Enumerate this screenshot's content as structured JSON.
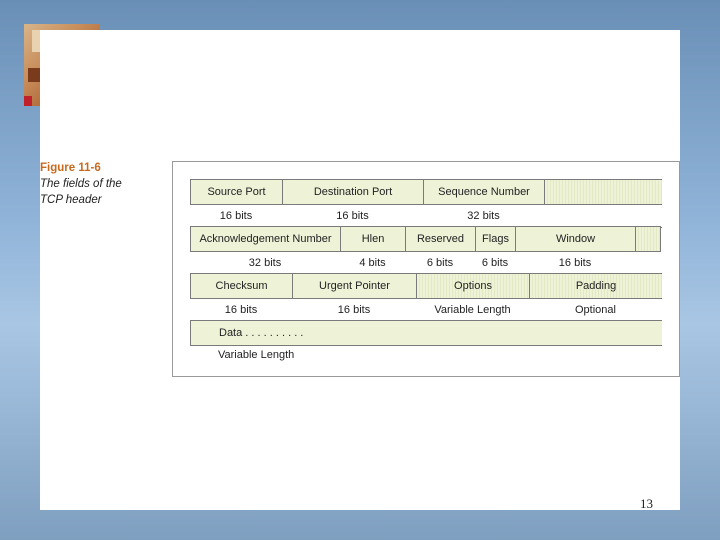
{
  "figure": {
    "label": "Figure 11-6",
    "caption_lines": [
      "The fields of the",
      "TCP header"
    ]
  },
  "rows": [
    {
      "fields": [
        "Source Port",
        "Destination Port",
        "Sequence Number",
        ""
      ],
      "sizes": [
        "16 bits",
        "16 bits",
        "32 bits",
        ""
      ]
    },
    {
      "fields": [
        "Acknowledgement Number",
        "Hlen",
        "Reserved",
        "Flags",
        "Window",
        ""
      ],
      "sizes": [
        "32 bits",
        "4 bits",
        "6 bits",
        "6 bits",
        "16 bits",
        ""
      ]
    },
    {
      "fields": [
        "Checksum",
        "Urgent Pointer",
        "Options",
        "Padding"
      ],
      "sizes": [
        "16 bits",
        "16 bits",
        "Variable Length",
        "Optional"
      ]
    },
    {
      "fields": [
        "Data . . . . . . . . . ."
      ],
      "sizes": [
        "Variable Length"
      ]
    }
  ],
  "page_number": "13",
  "colors": {
    "field_fill": "#eef3d8",
    "figure_label": "#c86a1e"
  }
}
